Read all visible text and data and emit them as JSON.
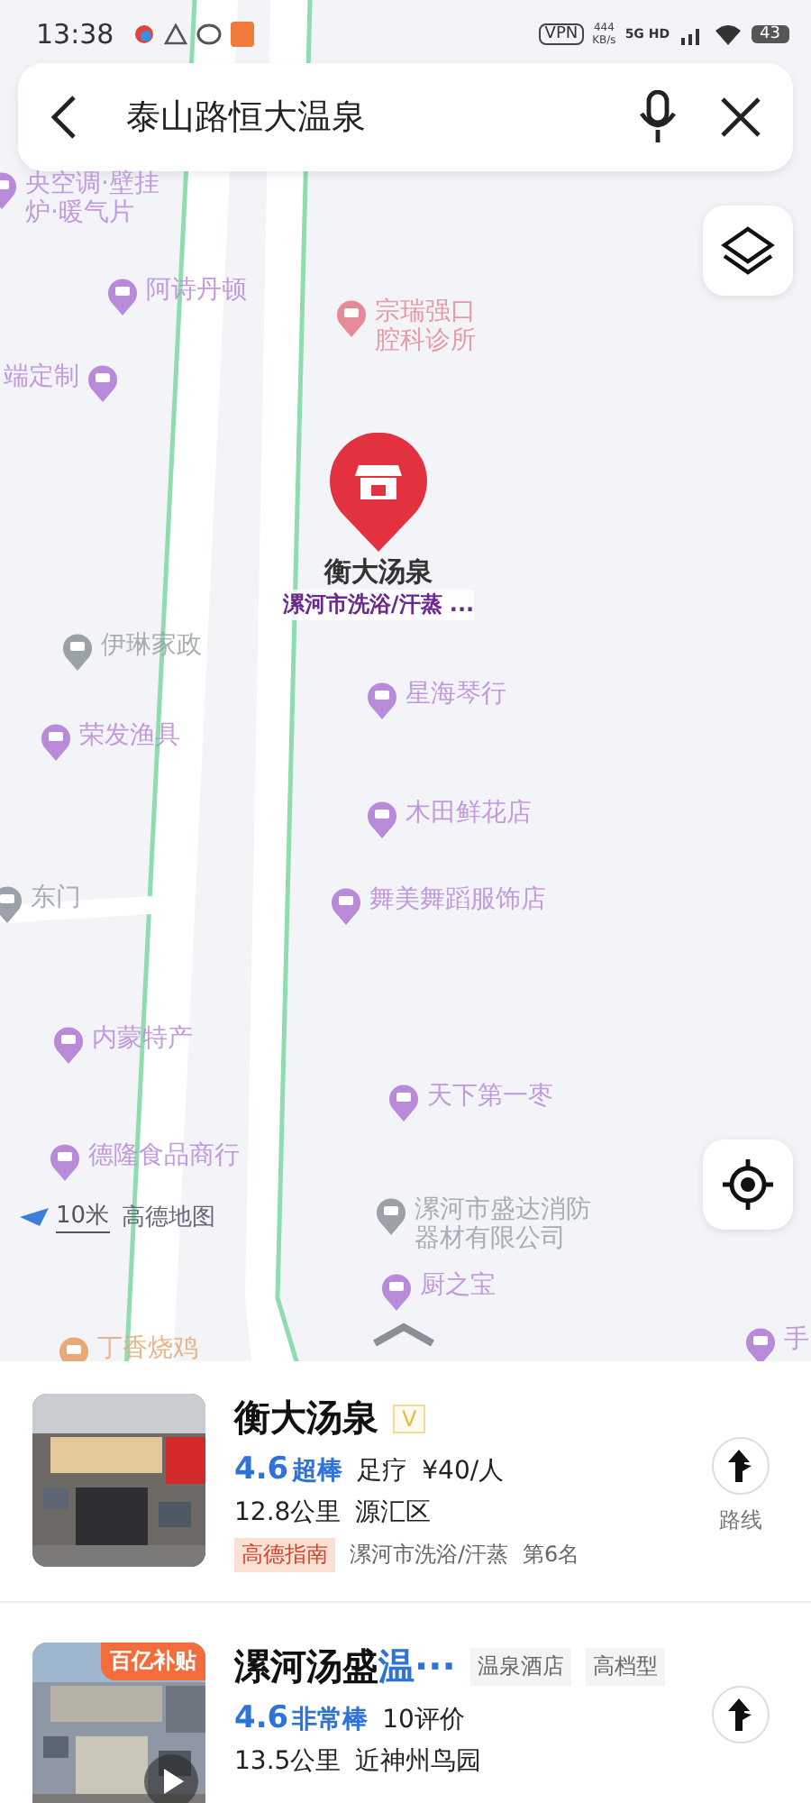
{
  "status_bar": {
    "time": "13:38",
    "vpn": "VPN",
    "speed": "444",
    "speed_unit": "KB/s",
    "network": "5G HD",
    "battery": "43"
  },
  "search": {
    "value": "泰山路恒大温泉"
  },
  "map": {
    "pois": [
      {
        "name": "央空调·壁挂炉·暖气片",
        "color": "#b98ad8"
      },
      {
        "name": "阿诗丹顿",
        "color": "#b98ad8"
      },
      {
        "name": "宗瑞强口腔科诊所",
        "color": "#e68a98"
      },
      {
        "name": "端定制",
        "color": "#b98ad8"
      },
      {
        "name": "伊琳家政",
        "color": "#9ba1a8"
      },
      {
        "name": "荣发渔具",
        "color": "#b98ad8"
      },
      {
        "name": "星海琴行",
        "color": "#b98ad8"
      },
      {
        "name": "木田鲜花店",
        "color": "#b98ad8"
      },
      {
        "name": "东门",
        "color": "#9ba1a8"
      },
      {
        "name": "舞美舞蹈服饰店",
        "color": "#b98ad8"
      },
      {
        "name": "内蒙特产",
        "color": "#b98ad8"
      },
      {
        "name": "天下第一枣",
        "color": "#b98ad8"
      },
      {
        "name": "德隆食品商行",
        "color": "#b98ad8"
      },
      {
        "name": "漯河市盛达消防器材有限公司",
        "color": "#9ba1a8"
      },
      {
        "name": "厨之宝",
        "color": "#b98ad8"
      },
      {
        "name": "丁香烧鸡",
        "color": "#e8a878"
      },
      {
        "name": "手",
        "color": "#b98ad8"
      }
    ],
    "selected": {
      "name": "衡大汤泉",
      "category": "漯河市洗浴/汗蒸 ..."
    },
    "scale": "10米",
    "logo": "高德地图"
  },
  "results": [
    {
      "title_parts": [
        {
          "text": "衡大汤泉",
          "highlight": false
        }
      ],
      "verified": "V",
      "rating": "4.6",
      "rating_word": "超棒",
      "extras": [
        "足疗",
        "¥40/人"
      ],
      "distance": "12.8公里",
      "area": "源汇区",
      "guide": {
        "logo": "高德指南",
        "list": "漯河市洗浴/汗蒸",
        "rank": "第6名"
      },
      "route_label": "路线"
    },
    {
      "title_parts": [
        {
          "text": "漯河汤盛",
          "highlight": false
        },
        {
          "text": "温···",
          "highlight": true
        }
      ],
      "tags": [
        "温泉酒店",
        "高档型"
      ],
      "photo_badge": "百亿补贴",
      "video": true,
      "rating": "4.6",
      "rating_word": "非常棒",
      "extras": [
        "10评价"
      ],
      "distance": "13.5公里",
      "area": "近神州鸟园"
    }
  ]
}
